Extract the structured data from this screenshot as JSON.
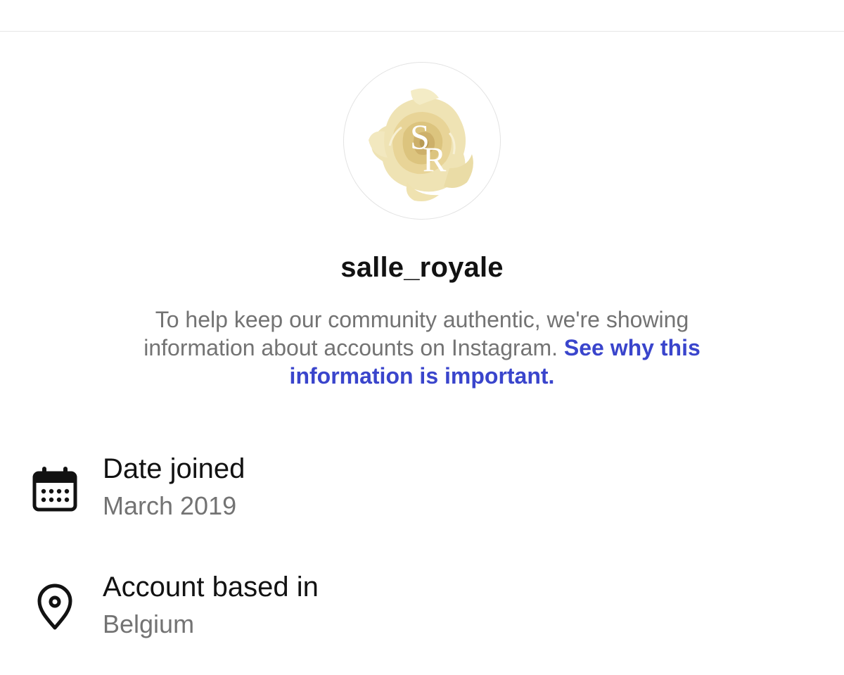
{
  "profile": {
    "avatar_icon": "rose-monogram-logo",
    "avatar_monogram": "SR",
    "username": "salle_royale"
  },
  "explainer": {
    "text": "To help keep our community authentic, we're showing information about accounts on Instagram.",
    "link_text": "See why this information is important."
  },
  "details": [
    {
      "icon": "calendar-icon",
      "title": "Date joined",
      "value": "March 2019"
    },
    {
      "icon": "location-pin-icon",
      "title": "Account based in",
      "value": "Belgium"
    }
  ],
  "colors": {
    "text_primary": "#121212",
    "text_secondary": "#737373",
    "link": "#3a45cc",
    "divider": "#e6e6e6"
  }
}
